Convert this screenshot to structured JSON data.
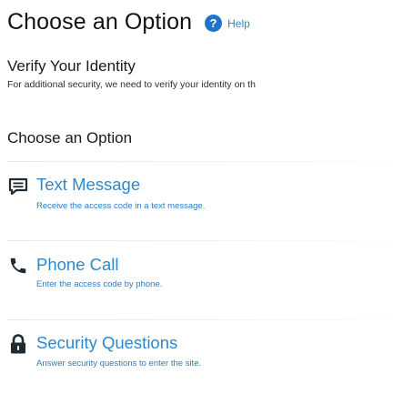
{
  "header": {
    "title": "Choose an Option",
    "help_label": "Help"
  },
  "verify": {
    "heading": "Verify Your Identity",
    "description": "For additional security, we need to verify your identity on th"
  },
  "options_section": {
    "heading": "Choose an Option",
    "options": [
      {
        "title": "Text Message",
        "description": "Receive the access code in a text message.",
        "icon": "chat-icon"
      },
      {
        "title": "Phone Call",
        "description": "Enter the access code by phone.",
        "icon": "phone-icon"
      },
      {
        "title": "Security Questions",
        "description": "Answer security questions to enter the site.",
        "icon": "lock-icon"
      }
    ]
  },
  "colors": {
    "link_blue": "#2f88cb",
    "help_icon_blue": "#1f73c8",
    "icon_dark": "#1f2a33"
  }
}
